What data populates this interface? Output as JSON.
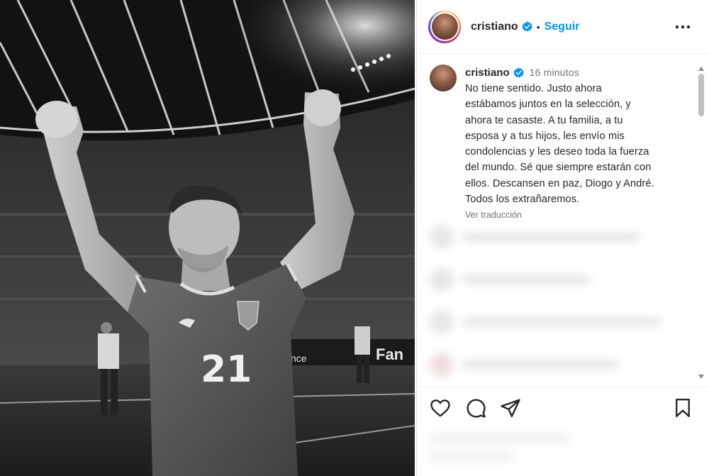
{
  "header": {
    "username": "cristiano",
    "separator": "•",
    "follow_label": "Seguir",
    "more_icon": "more-horizontal-icon"
  },
  "caption": {
    "username": "cristiano",
    "time": "16 minutos",
    "lines": [
      "No tiene sentido. Justo ahora",
      "estábamos juntos en la selección, y",
      "ahora te casaste. A tu familia, a tu",
      "esposa y a tus hijos, les envío mis",
      "condolencias y les deseo toda la fuerza",
      "del mundo. Sé que siempre estarán con",
      "ellos. Descansen en paz, Diogo y André.",
      "Todos los extrañaremos."
    ],
    "translate_label": "Ver traducción"
  },
  "photo": {
    "jersey_number": "21",
    "ad_text": "Fan",
    "ad_text_2": "nce"
  },
  "actions": {
    "like_icon": "heart-icon",
    "comment_icon": "comment-icon",
    "share_icon": "share-icon",
    "save_icon": "bookmark-icon"
  },
  "colors": {
    "accent": "#0095f6",
    "verified": "#0095f6",
    "text": "#262626",
    "muted": "#737373"
  }
}
